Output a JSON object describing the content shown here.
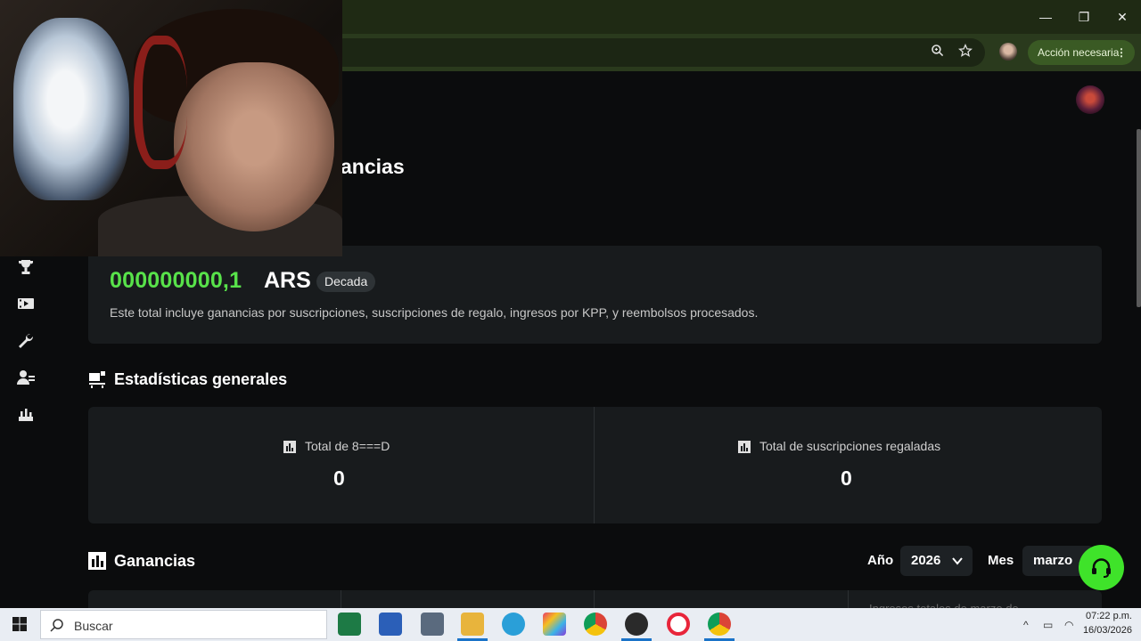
{
  "browser": {
    "action_button_label": "Acción necesaria",
    "window_controls": {
      "minimize": "—",
      "restore": "❐",
      "close": "✕"
    }
  },
  "page": {
    "title_partial": "ancias",
    "total": {
      "amount": "000000000,1",
      "currency": "ARS",
      "badge": "Decada",
      "description": "Este total incluye ganancias por suscripciones, suscripciones de regalo, ingresos por KPP, y reembolsos procesados."
    },
    "general_stats": {
      "title": "Estadísticas generales",
      "items": [
        {
          "label": "Total de 8===D",
          "value": "0"
        },
        {
          "label": "Total de suscripciones regaladas",
          "value": "0"
        }
      ]
    },
    "earnings": {
      "title": "Ganancias",
      "year_label": "Año",
      "year_value": "2026",
      "month_label": "Mes",
      "month_value": "marzo",
      "bottom_text_partial": "Ingresos totales de marzo de"
    },
    "sidebar_icons": [
      "trophy-icon",
      "video-icon",
      "wrench-icon",
      "users-icon",
      "sale-icon"
    ]
  },
  "taskbar": {
    "search_placeholder": "Buscar",
    "time": "07:22 p.m.",
    "date": "16/03/2026",
    "apps": [
      "excel",
      "word",
      "calculator",
      "file-explorer",
      "telegram",
      "app-colorful",
      "chrome",
      "obs",
      "opera",
      "chrome-profile"
    ]
  },
  "colors": {
    "accent_green": "#58e24a",
    "help_button": "#3fe32a",
    "browser_toolbar": "#2a3a1d"
  }
}
